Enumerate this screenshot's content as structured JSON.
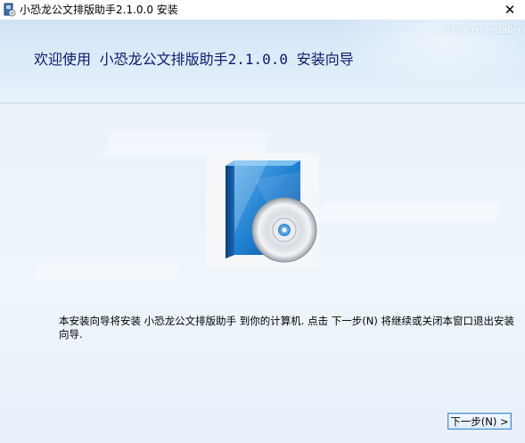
{
  "window": {
    "title": "小恐龙公文排版助手2.1.0.0 安装",
    "close_glyph": "✕"
  },
  "header": {
    "title": "欢迎使用 小恐龙公文排版助手2.1.0.0 安装向导",
    "brand": "Advanced Installer"
  },
  "main": {
    "description": "本安装向导将安装 小恐龙公文排版助手 到你的计算机. 点击 下一步(N) 将继续或关闭本窗口退出安装向导."
  },
  "footer": {
    "next_button": "下一步(N) >"
  },
  "colors": {
    "header_title": "#0b1a6b",
    "button_border": "#4d90d6"
  },
  "icons": {
    "app": "installer-icon",
    "product": "software-box-cd-icon"
  }
}
